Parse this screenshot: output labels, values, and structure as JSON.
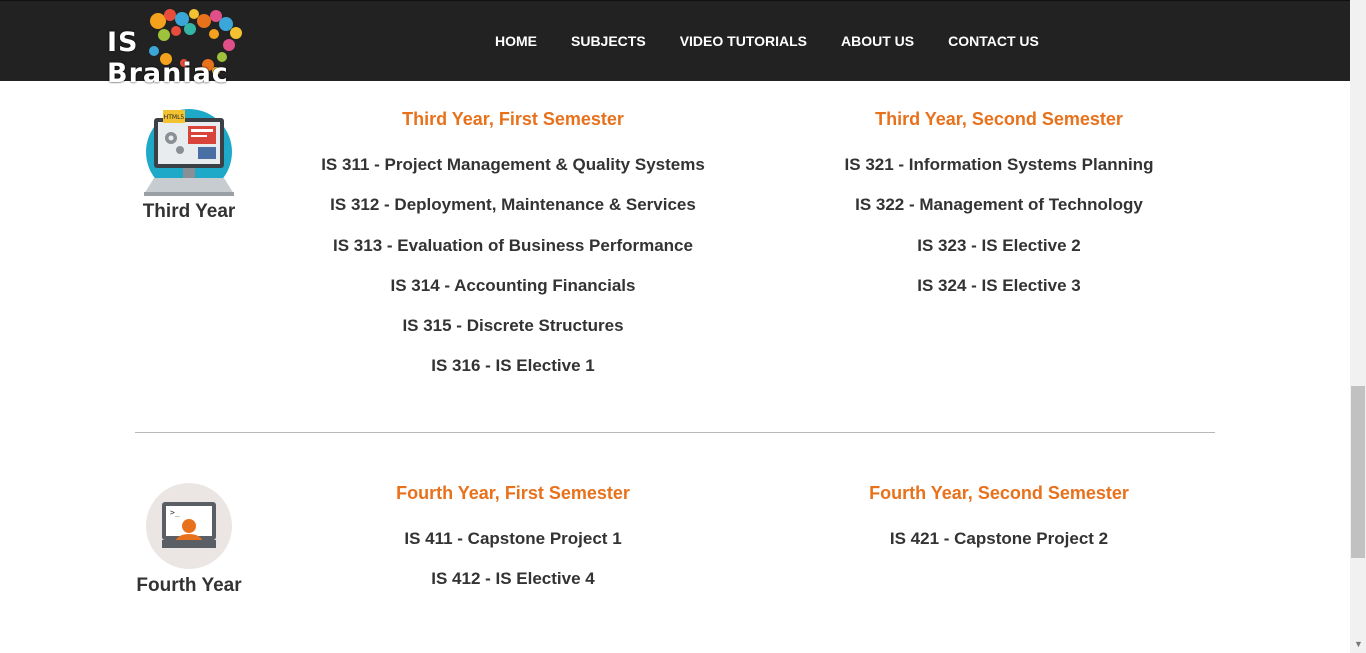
{
  "header": {
    "logo_text": "IS Braniac",
    "nav": [
      "HOME",
      "SUBJECTS",
      "VIDEO TUTORIALS",
      "ABOUT US",
      "CONTACT US"
    ]
  },
  "years": [
    {
      "label": "Third Year",
      "icon": "computer-dev-icon",
      "icon_badge": "HTML5",
      "semesters": [
        {
          "title": "Third Year, First Semester",
          "courses": [
            "IS 311 - Project Management & Quality Systems",
            "IS 312 - Deployment, Maintenance & Services",
            "IS 313 - Evaluation of Business Performance",
            "IS 314 - Accounting Financials",
            "IS 315 - Discrete Structures",
            "IS 316 - IS Elective 1"
          ]
        },
        {
          "title": "Third Year, Second Semester",
          "courses": [
            "IS 321 - Information Systems Planning",
            "IS 322 - Management of Technology",
            "IS 323 - IS Elective 2",
            "IS 324 - IS Elective 3"
          ]
        }
      ]
    },
    {
      "label": "Fourth Year",
      "icon": "terminal-user-icon",
      "icon_prompt": ">_",
      "semesters": [
        {
          "title": "Fourth Year, First Semester",
          "courses": [
            "IS 411 - Capstone Project 1",
            "IS 412 - IS Elective 4"
          ]
        },
        {
          "title": "Fourth Year, Second Semester",
          "courses": [
            "IS 421 - Capstone Project 2"
          ]
        }
      ]
    }
  ],
  "colors": {
    "header_bg": "#222222",
    "accent_orange": "#e8711c",
    "text_dark": "#333333"
  }
}
